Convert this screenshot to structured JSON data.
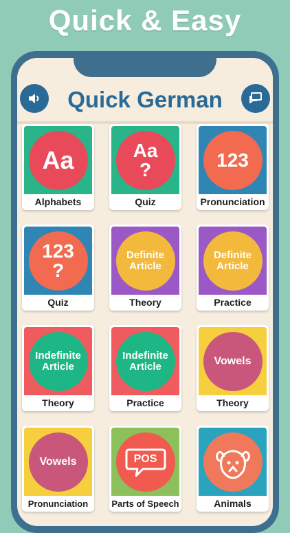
{
  "headline": "Quick & Easy",
  "app": {
    "title": "Quick German",
    "left_button_icon": "speaker-icon",
    "right_button_icon": "chat-icon"
  },
  "cards": [
    {
      "icon_text": "Aa",
      "icon_subtext": "",
      "label": "Alphabets",
      "bg": "#29b48a",
      "circle": "#e84a5a"
    },
    {
      "icon_text": "Aa",
      "icon_subtext": "?",
      "label": "Quiz",
      "bg": "#29b48a",
      "circle": "#e84a5a"
    },
    {
      "icon_text": "123",
      "icon_subtext": "",
      "label": "Pronunciation",
      "bg": "#2f86b5",
      "circle": "#f26a4f"
    },
    {
      "icon_text": "123",
      "icon_subtext": "?",
      "label": "Quiz",
      "bg": "#2f86b5",
      "circle": "#f26a4f"
    },
    {
      "icon_text": "Definite",
      "icon_subtext": "Article",
      "label": "Theory",
      "bg": "#9b59c6",
      "circle": "#f2b93d"
    },
    {
      "icon_text": "Definite",
      "icon_subtext": "Article",
      "label": "Practice",
      "bg": "#9b59c6",
      "circle": "#f2b93d"
    },
    {
      "icon_text": "Indefinite",
      "icon_subtext": "Article",
      "label": "Theory",
      "bg": "#f05b60",
      "circle": "#1fb685"
    },
    {
      "icon_text": "Indefinite",
      "icon_subtext": "Article",
      "label": "Practice",
      "bg": "#f05b60",
      "circle": "#1fb685"
    },
    {
      "icon_text": "Vowels",
      "icon_subtext": "",
      "label": "Theory",
      "bg": "#f6cf3e",
      "circle": "#c9577b"
    },
    {
      "icon_text": "Vowels",
      "icon_subtext": "",
      "label": "Pronunciation",
      "bg": "#f6cf3e",
      "circle": "#c9577b"
    },
    {
      "icon_text": "POS",
      "icon_subtext": "",
      "label": "Parts of Speech",
      "bg": "#8cc05b",
      "circle": "#f05a4f"
    },
    {
      "icon_text": "",
      "icon_subtext": "",
      "label": "Animals",
      "bg": "#2aa3bf",
      "circle": "#f0785b"
    }
  ]
}
